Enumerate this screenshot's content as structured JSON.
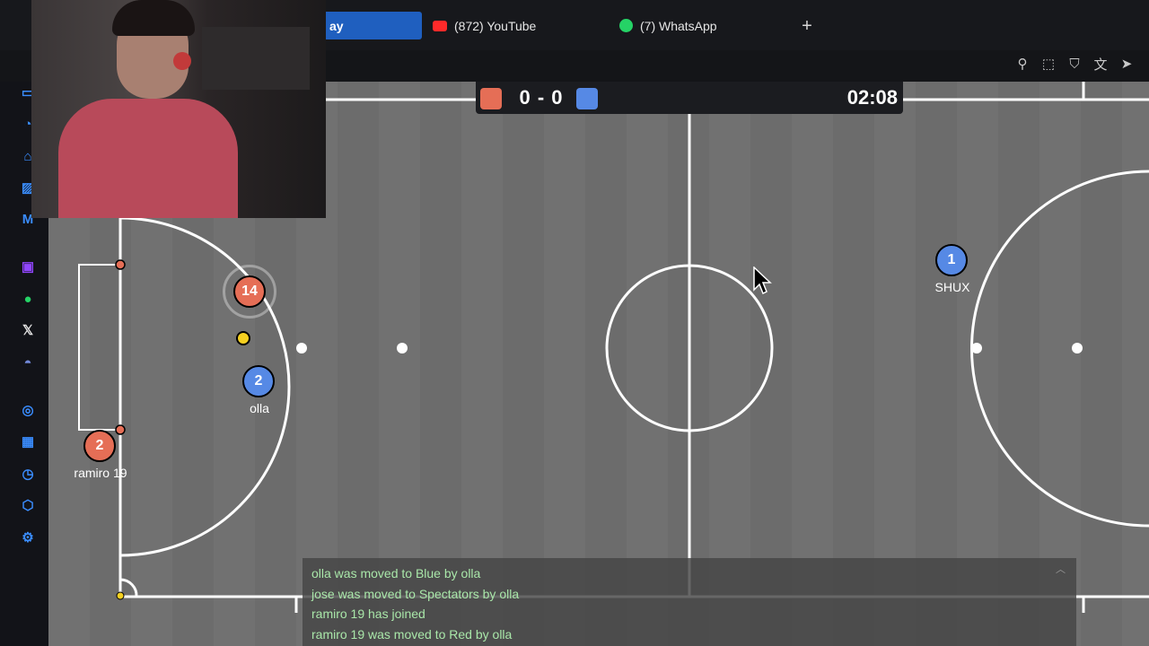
{
  "browser": {
    "active_tab": {
      "label": "ay"
    },
    "tabs": [
      {
        "label": "(872) YouTube",
        "icon": "youtube-icon"
      },
      {
        "label": "(7) WhatsApp",
        "icon": "whatsapp-icon"
      }
    ],
    "new_tab_label": "+",
    "toolbar_icons": [
      "pin-icon",
      "screenshot-icon",
      "shield-icon",
      "translate-icon",
      "send-icon"
    ]
  },
  "sidebar": {
    "icons": [
      "messenger-icon",
      "speed-dial-icon",
      "layers-icon",
      "edit-icon",
      "gmail-icon",
      "twitch-icon",
      "whatsapp-icon",
      "x-icon",
      "discord-icon",
      "opera-icon",
      "grid-icon",
      "history-icon",
      "extensions-icon",
      "settings-icon"
    ]
  },
  "scoreboard": {
    "score": "0 - 0",
    "red_score": 0,
    "blue_score": 0,
    "timer": "02:08",
    "red_color": "#e56e56",
    "blue_color": "#5689e5"
  },
  "players": [
    {
      "number": "14",
      "team": "red",
      "name": ""
    },
    {
      "number": "2",
      "team": "blue",
      "name": "olla"
    },
    {
      "number": "2",
      "team": "red",
      "name": "ramiro 19"
    },
    {
      "number": "1",
      "team": "blue",
      "name": "SHUX"
    }
  ],
  "chat": {
    "messages": [
      "olla was moved to Blue by olla",
      "jose was moved to Spectators by olla",
      "ramiro 19 has joined",
      "ramiro 19 was moved to Red by olla"
    ],
    "collapse_icon": "chevron-up-icon"
  },
  "colors": {
    "field": "#6e6e6e",
    "lines": "#ffffff",
    "chat_text": "#a9e7a9",
    "ball": "#f5d020"
  }
}
